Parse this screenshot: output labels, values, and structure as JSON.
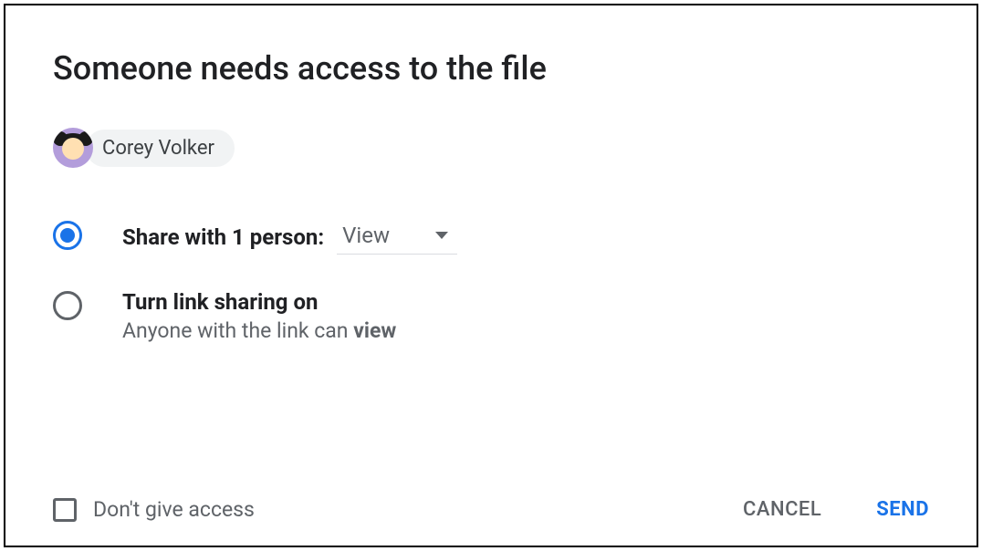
{
  "dialog": {
    "title": "Someone needs access to the file",
    "user": {
      "name": "Corey Volker"
    },
    "options": {
      "share": {
        "label": "Share with 1 person:",
        "dropdown_value": "View"
      },
      "link": {
        "label": "Turn link sharing on",
        "sub_prefix": "Anyone with the link can ",
        "sub_bold": "view"
      }
    },
    "footer": {
      "checkbox_label": "Don't give access",
      "cancel": "CANCEL",
      "send": "SEND"
    }
  }
}
